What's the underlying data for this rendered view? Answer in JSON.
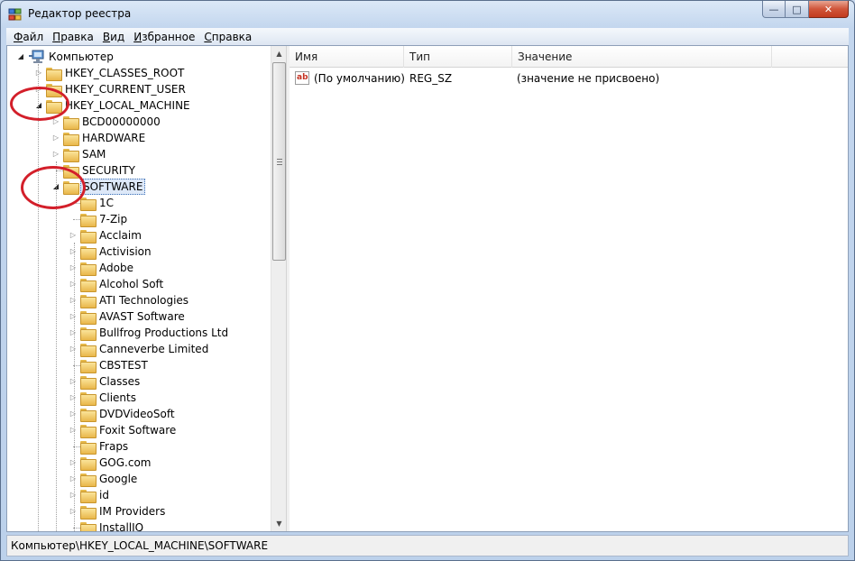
{
  "window": {
    "title": "Редактор реестра"
  },
  "caption_buttons": {
    "minimize": "—",
    "maximize": "□",
    "close": "✕"
  },
  "menu": {
    "items": [
      {
        "accel": "Ф",
        "rest": "айл"
      },
      {
        "accel": "П",
        "rest": "равка"
      },
      {
        "accel": "В",
        "rest": "ид"
      },
      {
        "accel": "И",
        "rest": "збранное"
      },
      {
        "accel": "С",
        "rest": "правка"
      }
    ]
  },
  "tree": {
    "root": "Компьютер",
    "nodes": [
      {
        "label": "HKEY_CLASSES_ROOT",
        "level": 1,
        "state": "collapsed"
      },
      {
        "label": "HKEY_CURRENT_USER",
        "level": 1,
        "state": "collapsed"
      },
      {
        "label": "HKEY_LOCAL_MACHINE",
        "level": 1,
        "state": "expanded"
      },
      {
        "label": "BCD00000000",
        "level": 2,
        "state": "collapsed"
      },
      {
        "label": "HARDWARE",
        "level": 2,
        "state": "collapsed"
      },
      {
        "label": "SAM",
        "level": 2,
        "state": "collapsed"
      },
      {
        "label": "SECURITY",
        "level": 2,
        "state": "leaf"
      },
      {
        "label": "SOFTWARE",
        "level": 2,
        "state": "expanded",
        "selected": true
      },
      {
        "label": "1C",
        "level": 3,
        "state": "leaf"
      },
      {
        "label": "7-Zip",
        "level": 3,
        "state": "leaf"
      },
      {
        "label": "Acclaim",
        "level": 3,
        "state": "collapsed"
      },
      {
        "label": "Activision",
        "level": 3,
        "state": "collapsed"
      },
      {
        "label": "Adobe",
        "level": 3,
        "state": "collapsed"
      },
      {
        "label": "Alcohol Soft",
        "level": 3,
        "state": "collapsed"
      },
      {
        "label": "ATI Technologies",
        "level": 3,
        "state": "collapsed"
      },
      {
        "label": "AVAST Software",
        "level": 3,
        "state": "collapsed"
      },
      {
        "label": "Bullfrog Productions Ltd",
        "level": 3,
        "state": "collapsed"
      },
      {
        "label": "Canneverbe Limited",
        "level": 3,
        "state": "collapsed"
      },
      {
        "label": "CBSTEST",
        "level": 3,
        "state": "leaf"
      },
      {
        "label": "Classes",
        "level": 3,
        "state": "collapsed"
      },
      {
        "label": "Clients",
        "level": 3,
        "state": "collapsed"
      },
      {
        "label": "DVDVideoSoft",
        "level": 3,
        "state": "collapsed"
      },
      {
        "label": "Foxit Software",
        "level": 3,
        "state": "collapsed"
      },
      {
        "label": "Fraps",
        "level": 3,
        "state": "leaf"
      },
      {
        "label": "GOG.com",
        "level": 3,
        "state": "collapsed"
      },
      {
        "label": "Google",
        "level": 3,
        "state": "collapsed"
      },
      {
        "label": "id",
        "level": 3,
        "state": "collapsed"
      },
      {
        "label": "IM Providers",
        "level": 3,
        "state": "collapsed"
      },
      {
        "label": "InstallIQ",
        "level": 3,
        "state": "leaf"
      }
    ]
  },
  "list": {
    "columns": [
      "Имя",
      "Тип",
      "Значение"
    ],
    "rows": [
      {
        "name": "(По умолчанию)",
        "type": "REG_SZ",
        "value": "(значение не присвоено)"
      }
    ]
  },
  "statusbar": {
    "path": "Компьютер\\HKEY_LOCAL_MACHINE\\SOFTWARE"
  },
  "colors": {
    "annotation": "#d31f2a",
    "selection_border": "#3a6fb5"
  },
  "icons": {
    "app": "registry-editor-icon",
    "root": "computer-icon",
    "node": "folder-icon",
    "value": "string-value-icon"
  }
}
